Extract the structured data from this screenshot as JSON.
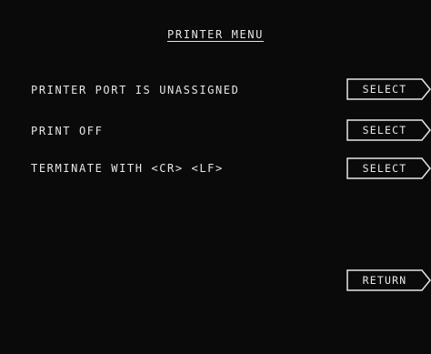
{
  "screen": {
    "title": "PRINTER MENU",
    "options": [
      {
        "label": "PRINTER PORT IS UNASSIGNED",
        "button": "SELECT"
      },
      {
        "label": "PRINT OFF",
        "button": "SELECT"
      },
      {
        "label": "TERMINATE WITH <CR> <LF>",
        "button": "SELECT"
      }
    ],
    "return_label": "RETURN"
  },
  "colors": {
    "background": "#0a0a0a",
    "text": "#e6e6e6"
  }
}
